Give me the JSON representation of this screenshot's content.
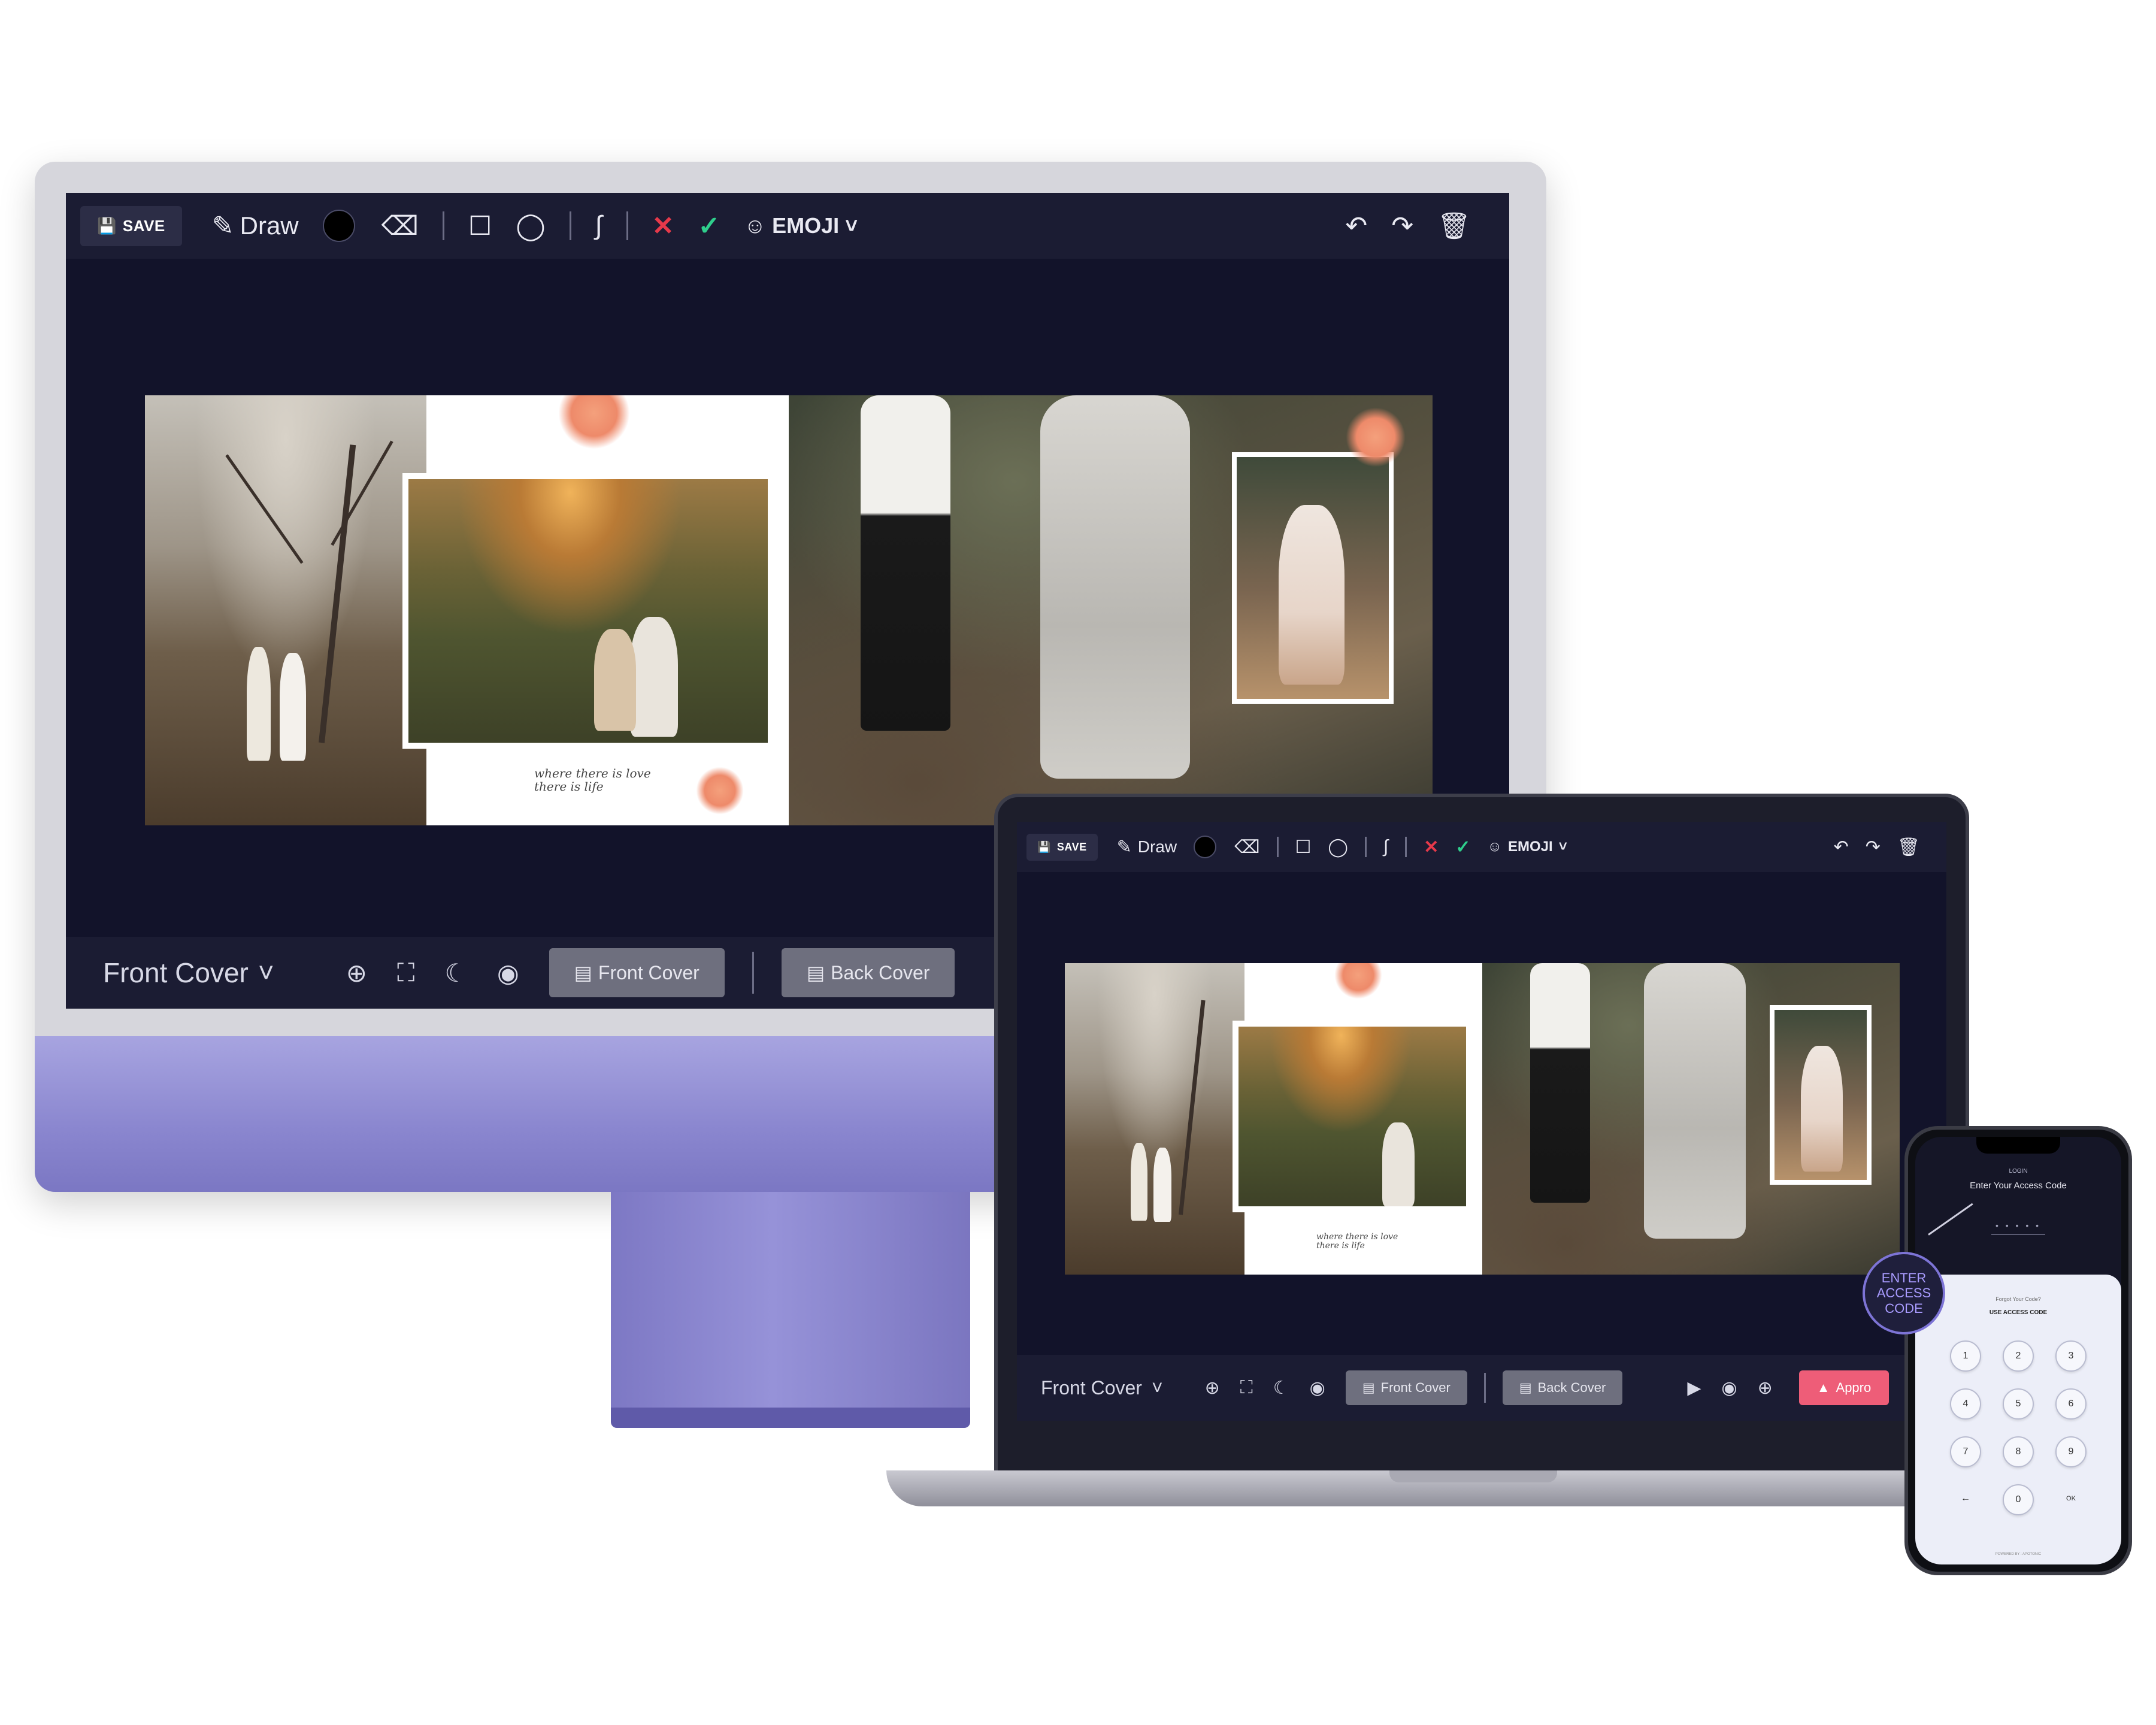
{
  "desktop": {
    "toolbar": {
      "save_label": "SAVE",
      "draw_label": "Draw",
      "emoji_label": "EMOJI"
    },
    "album": {
      "quote_line1": "where there is love",
      "quote_line2": "there is life"
    },
    "bottombar": {
      "cover_select": "Front Cover",
      "front_cover_btn": "Front Cover",
      "back_cover_btn": "Back Cover"
    }
  },
  "laptop": {
    "toolbar": {
      "save_label": "SAVE",
      "draw_label": "Draw",
      "emoji_label": "EMOJI"
    },
    "album": {
      "quote_line1": "where there is love",
      "quote_line2": "there is life"
    },
    "bottombar": {
      "cover_select": "Front Cover",
      "front_cover_btn": "Front Cover",
      "back_cover_btn": "Back Cover",
      "approve_btn": "Appro"
    }
  },
  "phone": {
    "login_label": "LOGIN",
    "title": "Enter Your Access Code",
    "code_placeholder": "• • • • •",
    "forgot": "Forgot Your Code?",
    "use_code": "USE ACCESS CODE",
    "keys": [
      "1",
      "2",
      "3",
      "4",
      "5",
      "6",
      "7",
      "8",
      "9",
      "←",
      "0",
      "OK"
    ],
    "powered_by": "POWERED BY : APOTONIC"
  },
  "callout": {
    "line1": "ENTER",
    "line2": "ACCESS",
    "line3": "CODE"
  },
  "colors": {
    "screen_bg": "#12132a",
    "toolbar_bg": "#1b1c33",
    "imac_chin": "#8a86cf",
    "cancel_red": "#e6394a",
    "confirm_green": "#2fce8c",
    "approve_pink": "#ee5d78"
  }
}
